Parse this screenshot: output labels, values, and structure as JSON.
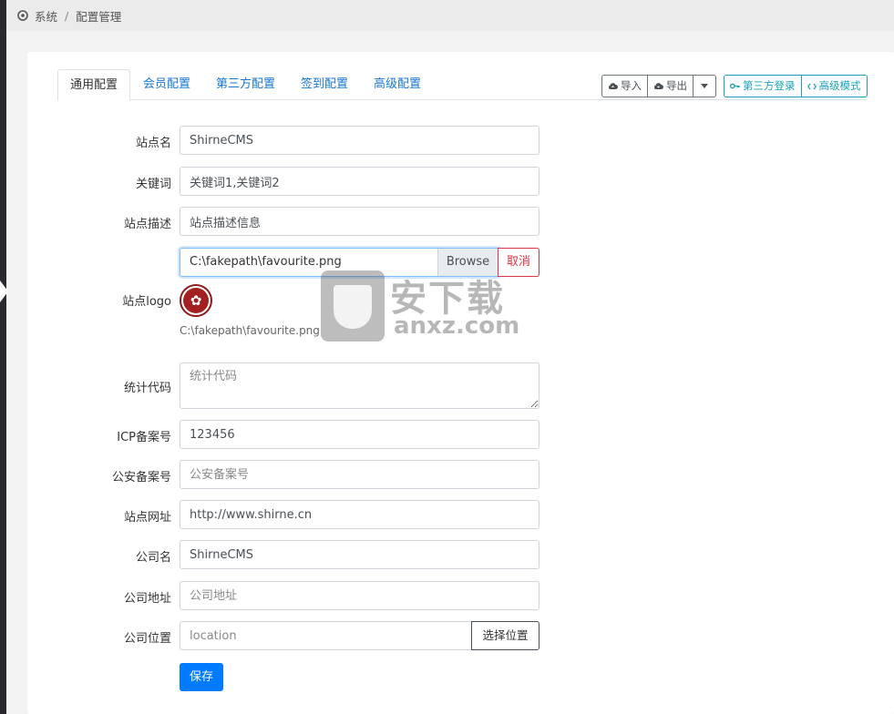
{
  "breadcrumb": {
    "root": "系统",
    "separator": "/",
    "current": "配置管理"
  },
  "tabs": [
    {
      "label": "通用配置",
      "active": true
    },
    {
      "label": "会员配置"
    },
    {
      "label": "第三方配置"
    },
    {
      "label": "签到配置"
    },
    {
      "label": "高级配置"
    }
  ],
  "toolbar": {
    "import_label": "导入",
    "export_label": "导出",
    "third_party_login_label": "第三方登录",
    "advanced_mode_label": "高级模式"
  },
  "form": {
    "site_name": {
      "label": "站点名",
      "value": "ShirneCMS"
    },
    "keywords": {
      "label": "关键词",
      "value": "关键词1,关键词2"
    },
    "description": {
      "label": "站点描述",
      "value": "站点描述信息"
    },
    "logo_file": {
      "path": "C:\\fakepath\\favourite.png",
      "browse_label": "Browse",
      "cancel_label": "取消"
    },
    "logo": {
      "label": "站点logo",
      "caption": "C:\\fakepath\\favourite.png"
    },
    "stats_code": {
      "label": "统计代码",
      "placeholder": "统计代码"
    },
    "icp": {
      "label": "ICP备案号",
      "value": "123456"
    },
    "police": {
      "label": "公安备案号",
      "placeholder": "公安备案号"
    },
    "site_url": {
      "label": "站点网址",
      "value": "http://www.shirne.cn"
    },
    "company_name": {
      "label": "公司名",
      "value": "ShirneCMS"
    },
    "company_address": {
      "label": "公司地址",
      "placeholder": "公司地址"
    },
    "company_location": {
      "label": "公司位置",
      "placeholder": "location",
      "picker_label": "选择位置"
    },
    "save_label": "保存"
  },
  "watermark": {
    "line1": "安下载",
    "line2": "anxz.com"
  },
  "colors": {
    "primary": "#007bff",
    "link": "#1976d2",
    "info": "#17a2b8",
    "danger": "#dc3545"
  }
}
